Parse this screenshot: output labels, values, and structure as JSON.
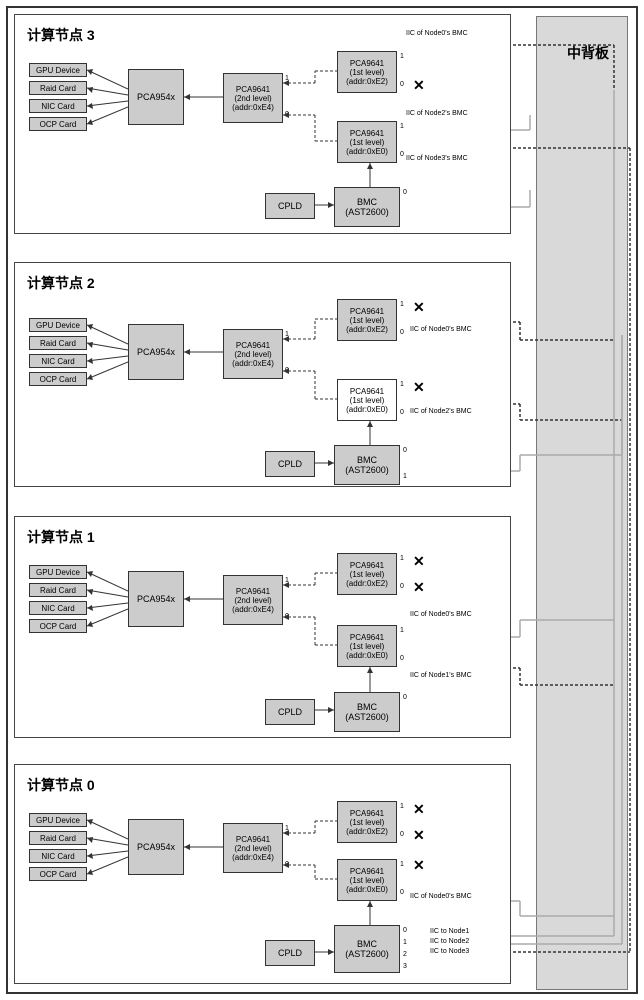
{
  "backplane": {
    "title": "中背板"
  },
  "nodes": [
    {
      "id": 3,
      "title": "计算节点 3"
    },
    {
      "id": 2,
      "title": "计算节点 2"
    },
    {
      "id": 1,
      "title": "计算节点 1"
    },
    {
      "id": 0,
      "title": "计算节点 0"
    }
  ],
  "devices": [
    "GPU Device",
    "Raid Card",
    "NIC Card",
    "OCP Card"
  ],
  "chips": {
    "pca954x": "PCA954x",
    "pca9641_l2": {
      "name": "PCA9641",
      "level": "(2nd level)",
      "addr": "(addr:0xE4)"
    },
    "pca9641_l1_e2": {
      "name": "PCA9641",
      "level": "(1st level)",
      "addr": "(addr:0xE2)"
    },
    "pca9641_l1_e0": {
      "name": "PCA9641",
      "level": "(1st level)",
      "addr": "(addr:0xE0)"
    },
    "cpld": "CPLD",
    "bmc": {
      "name": "BMC",
      "model": "(AST2600)"
    }
  },
  "labels": {
    "iic_node0": "IIC of Node0's BMC",
    "iic_node1": "IIC of Node1's BMC",
    "iic_node2": "IIC of Node2's BMC",
    "iic_node3": "IIC of Node3's BMC",
    "iic_to_node1": "IIC to Node1",
    "iic_to_node2": "IIC to Node2",
    "iic_to_node3": "IIC to Node3"
  },
  "pins": {
    "p0": "0",
    "p1": "1",
    "p2": "2",
    "p3": "3"
  }
}
